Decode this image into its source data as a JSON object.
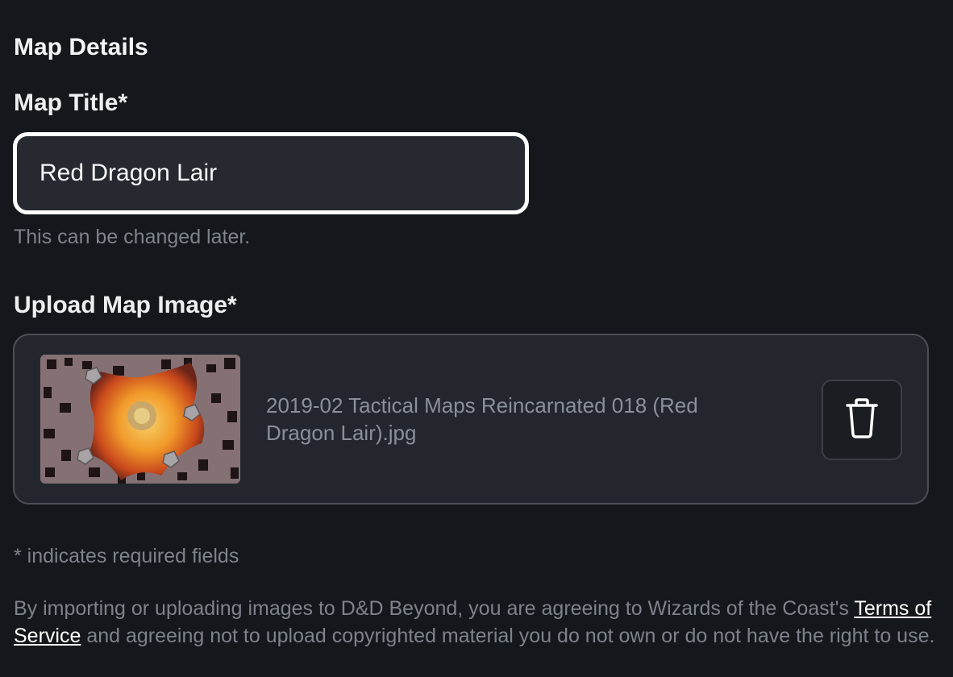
{
  "section": {
    "title": "Map Details"
  },
  "map_title": {
    "label": "Map Title*",
    "value": "Red Dragon Lair",
    "hint": "This can be changed later."
  },
  "upload": {
    "label": "Upload Map Image*",
    "file_name": "2019-02 Tactical Maps Reincarnated 018 (Red Dragon Lair).jpg",
    "thumbnail_icon": "map-thumbnail",
    "delete_icon": "trash-icon"
  },
  "footer": {
    "required_note": "* indicates required fields",
    "legal_before": "By importing or uploading images to D&D Beyond, you are agreeing to Wizards of the Coast's ",
    "legal_link": "Terms of Service",
    "legal_after": " and agreeing not to upload copyrighted material you do not own or do not have the right to use."
  },
  "colors": {
    "background": "#14171b",
    "input_border": "#ffffff",
    "muted_text": "#7d838c"
  }
}
